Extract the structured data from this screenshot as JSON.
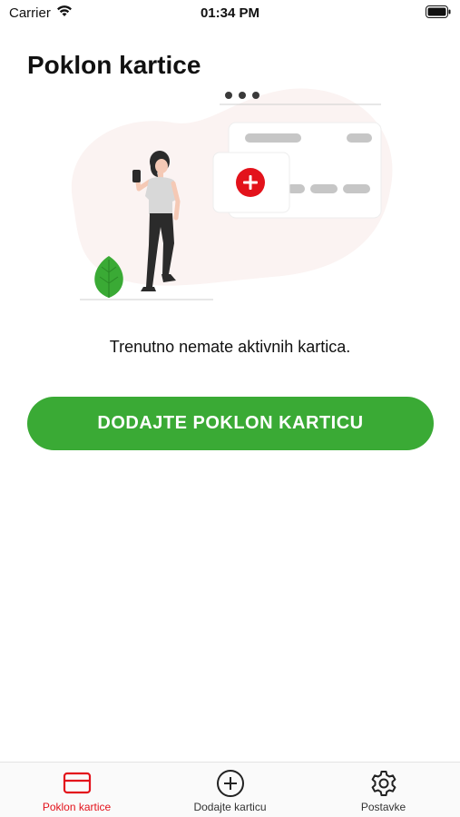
{
  "status_bar": {
    "carrier": "Carrier",
    "time": "01:34 PM",
    "wifi_icon": "wifi-icon",
    "battery_icon": "battery-icon"
  },
  "header": {
    "title": "Poklon kartice"
  },
  "empty_state": {
    "message": "Trenutno nemate aktivnih kartica.",
    "button_label": "DODAJTE POKLON KARTICU",
    "illustration": "woman-with-phone-and-cards-illustration"
  },
  "tab_bar": {
    "items": [
      {
        "label": "Poklon kartice",
        "icon": "credit-card-icon",
        "active": true
      },
      {
        "label": "Dodajte karticu",
        "icon": "plus-circle-icon",
        "active": false
      },
      {
        "label": "Postavke",
        "icon": "gear-icon",
        "active": false
      }
    ]
  },
  "colors": {
    "accent": "#e3121b",
    "button": "#3aaa35",
    "leaf": "#3aaa35"
  }
}
